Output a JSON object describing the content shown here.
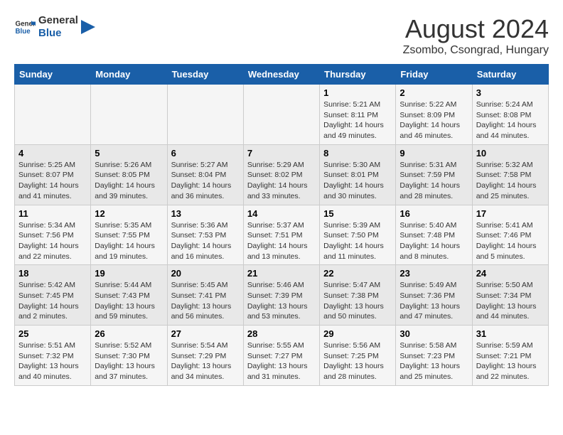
{
  "header": {
    "logo_general": "General",
    "logo_blue": "Blue",
    "month_title": "August 2024",
    "location": "Zsombo, Csongrad, Hungary"
  },
  "weekdays": [
    "Sunday",
    "Monday",
    "Tuesday",
    "Wednesday",
    "Thursday",
    "Friday",
    "Saturday"
  ],
  "weeks": [
    [
      {
        "day": "",
        "info": ""
      },
      {
        "day": "",
        "info": ""
      },
      {
        "day": "",
        "info": ""
      },
      {
        "day": "",
        "info": ""
      },
      {
        "day": "1",
        "info": "Sunrise: 5:21 AM\nSunset: 8:11 PM\nDaylight: 14 hours\nand 49 minutes."
      },
      {
        "day": "2",
        "info": "Sunrise: 5:22 AM\nSunset: 8:09 PM\nDaylight: 14 hours\nand 46 minutes."
      },
      {
        "day": "3",
        "info": "Sunrise: 5:24 AM\nSunset: 8:08 PM\nDaylight: 14 hours\nand 44 minutes."
      }
    ],
    [
      {
        "day": "4",
        "info": "Sunrise: 5:25 AM\nSunset: 8:07 PM\nDaylight: 14 hours\nand 41 minutes."
      },
      {
        "day": "5",
        "info": "Sunrise: 5:26 AM\nSunset: 8:05 PM\nDaylight: 14 hours\nand 39 minutes."
      },
      {
        "day": "6",
        "info": "Sunrise: 5:27 AM\nSunset: 8:04 PM\nDaylight: 14 hours\nand 36 minutes."
      },
      {
        "day": "7",
        "info": "Sunrise: 5:29 AM\nSunset: 8:02 PM\nDaylight: 14 hours\nand 33 minutes."
      },
      {
        "day": "8",
        "info": "Sunrise: 5:30 AM\nSunset: 8:01 PM\nDaylight: 14 hours\nand 30 minutes."
      },
      {
        "day": "9",
        "info": "Sunrise: 5:31 AM\nSunset: 7:59 PM\nDaylight: 14 hours\nand 28 minutes."
      },
      {
        "day": "10",
        "info": "Sunrise: 5:32 AM\nSunset: 7:58 PM\nDaylight: 14 hours\nand 25 minutes."
      }
    ],
    [
      {
        "day": "11",
        "info": "Sunrise: 5:34 AM\nSunset: 7:56 PM\nDaylight: 14 hours\nand 22 minutes."
      },
      {
        "day": "12",
        "info": "Sunrise: 5:35 AM\nSunset: 7:55 PM\nDaylight: 14 hours\nand 19 minutes."
      },
      {
        "day": "13",
        "info": "Sunrise: 5:36 AM\nSunset: 7:53 PM\nDaylight: 14 hours\nand 16 minutes."
      },
      {
        "day": "14",
        "info": "Sunrise: 5:37 AM\nSunset: 7:51 PM\nDaylight: 14 hours\nand 13 minutes."
      },
      {
        "day": "15",
        "info": "Sunrise: 5:39 AM\nSunset: 7:50 PM\nDaylight: 14 hours\nand 11 minutes."
      },
      {
        "day": "16",
        "info": "Sunrise: 5:40 AM\nSunset: 7:48 PM\nDaylight: 14 hours\nand 8 minutes."
      },
      {
        "day": "17",
        "info": "Sunrise: 5:41 AM\nSunset: 7:46 PM\nDaylight: 14 hours\nand 5 minutes."
      }
    ],
    [
      {
        "day": "18",
        "info": "Sunrise: 5:42 AM\nSunset: 7:45 PM\nDaylight: 14 hours\nand 2 minutes."
      },
      {
        "day": "19",
        "info": "Sunrise: 5:44 AM\nSunset: 7:43 PM\nDaylight: 13 hours\nand 59 minutes."
      },
      {
        "day": "20",
        "info": "Sunrise: 5:45 AM\nSunset: 7:41 PM\nDaylight: 13 hours\nand 56 minutes."
      },
      {
        "day": "21",
        "info": "Sunrise: 5:46 AM\nSunset: 7:39 PM\nDaylight: 13 hours\nand 53 minutes."
      },
      {
        "day": "22",
        "info": "Sunrise: 5:47 AM\nSunset: 7:38 PM\nDaylight: 13 hours\nand 50 minutes."
      },
      {
        "day": "23",
        "info": "Sunrise: 5:49 AM\nSunset: 7:36 PM\nDaylight: 13 hours\nand 47 minutes."
      },
      {
        "day": "24",
        "info": "Sunrise: 5:50 AM\nSunset: 7:34 PM\nDaylight: 13 hours\nand 44 minutes."
      }
    ],
    [
      {
        "day": "25",
        "info": "Sunrise: 5:51 AM\nSunset: 7:32 PM\nDaylight: 13 hours\nand 40 minutes."
      },
      {
        "day": "26",
        "info": "Sunrise: 5:52 AM\nSunset: 7:30 PM\nDaylight: 13 hours\nand 37 minutes."
      },
      {
        "day": "27",
        "info": "Sunrise: 5:54 AM\nSunset: 7:29 PM\nDaylight: 13 hours\nand 34 minutes."
      },
      {
        "day": "28",
        "info": "Sunrise: 5:55 AM\nSunset: 7:27 PM\nDaylight: 13 hours\nand 31 minutes."
      },
      {
        "day": "29",
        "info": "Sunrise: 5:56 AM\nSunset: 7:25 PM\nDaylight: 13 hours\nand 28 minutes."
      },
      {
        "day": "30",
        "info": "Sunrise: 5:58 AM\nSunset: 7:23 PM\nDaylight: 13 hours\nand 25 minutes."
      },
      {
        "day": "31",
        "info": "Sunrise: 5:59 AM\nSunset: 7:21 PM\nDaylight: 13 hours\nand 22 minutes."
      }
    ]
  ]
}
